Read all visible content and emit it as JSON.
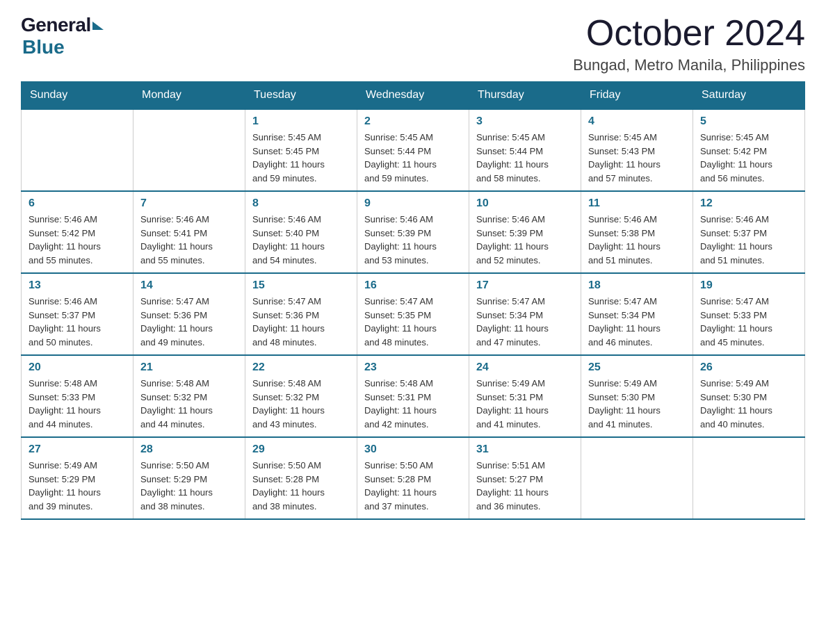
{
  "logo": {
    "general": "General",
    "blue": "Blue"
  },
  "header": {
    "month_year": "October 2024",
    "location": "Bungad, Metro Manila, Philippines"
  },
  "days_of_week": [
    "Sunday",
    "Monday",
    "Tuesday",
    "Wednesday",
    "Thursday",
    "Friday",
    "Saturday"
  ],
  "weeks": [
    [
      {
        "day": "",
        "info": ""
      },
      {
        "day": "",
        "info": ""
      },
      {
        "day": "1",
        "info": "Sunrise: 5:45 AM\nSunset: 5:45 PM\nDaylight: 11 hours\nand 59 minutes."
      },
      {
        "day": "2",
        "info": "Sunrise: 5:45 AM\nSunset: 5:44 PM\nDaylight: 11 hours\nand 59 minutes."
      },
      {
        "day": "3",
        "info": "Sunrise: 5:45 AM\nSunset: 5:44 PM\nDaylight: 11 hours\nand 58 minutes."
      },
      {
        "day": "4",
        "info": "Sunrise: 5:45 AM\nSunset: 5:43 PM\nDaylight: 11 hours\nand 57 minutes."
      },
      {
        "day": "5",
        "info": "Sunrise: 5:45 AM\nSunset: 5:42 PM\nDaylight: 11 hours\nand 56 minutes."
      }
    ],
    [
      {
        "day": "6",
        "info": "Sunrise: 5:46 AM\nSunset: 5:42 PM\nDaylight: 11 hours\nand 55 minutes."
      },
      {
        "day": "7",
        "info": "Sunrise: 5:46 AM\nSunset: 5:41 PM\nDaylight: 11 hours\nand 55 minutes."
      },
      {
        "day": "8",
        "info": "Sunrise: 5:46 AM\nSunset: 5:40 PM\nDaylight: 11 hours\nand 54 minutes."
      },
      {
        "day": "9",
        "info": "Sunrise: 5:46 AM\nSunset: 5:39 PM\nDaylight: 11 hours\nand 53 minutes."
      },
      {
        "day": "10",
        "info": "Sunrise: 5:46 AM\nSunset: 5:39 PM\nDaylight: 11 hours\nand 52 minutes."
      },
      {
        "day": "11",
        "info": "Sunrise: 5:46 AM\nSunset: 5:38 PM\nDaylight: 11 hours\nand 51 minutes."
      },
      {
        "day": "12",
        "info": "Sunrise: 5:46 AM\nSunset: 5:37 PM\nDaylight: 11 hours\nand 51 minutes."
      }
    ],
    [
      {
        "day": "13",
        "info": "Sunrise: 5:46 AM\nSunset: 5:37 PM\nDaylight: 11 hours\nand 50 minutes."
      },
      {
        "day": "14",
        "info": "Sunrise: 5:47 AM\nSunset: 5:36 PM\nDaylight: 11 hours\nand 49 minutes."
      },
      {
        "day": "15",
        "info": "Sunrise: 5:47 AM\nSunset: 5:36 PM\nDaylight: 11 hours\nand 48 minutes."
      },
      {
        "day": "16",
        "info": "Sunrise: 5:47 AM\nSunset: 5:35 PM\nDaylight: 11 hours\nand 48 minutes."
      },
      {
        "day": "17",
        "info": "Sunrise: 5:47 AM\nSunset: 5:34 PM\nDaylight: 11 hours\nand 47 minutes."
      },
      {
        "day": "18",
        "info": "Sunrise: 5:47 AM\nSunset: 5:34 PM\nDaylight: 11 hours\nand 46 minutes."
      },
      {
        "day": "19",
        "info": "Sunrise: 5:47 AM\nSunset: 5:33 PM\nDaylight: 11 hours\nand 45 minutes."
      }
    ],
    [
      {
        "day": "20",
        "info": "Sunrise: 5:48 AM\nSunset: 5:33 PM\nDaylight: 11 hours\nand 44 minutes."
      },
      {
        "day": "21",
        "info": "Sunrise: 5:48 AM\nSunset: 5:32 PM\nDaylight: 11 hours\nand 44 minutes."
      },
      {
        "day": "22",
        "info": "Sunrise: 5:48 AM\nSunset: 5:32 PM\nDaylight: 11 hours\nand 43 minutes."
      },
      {
        "day": "23",
        "info": "Sunrise: 5:48 AM\nSunset: 5:31 PM\nDaylight: 11 hours\nand 42 minutes."
      },
      {
        "day": "24",
        "info": "Sunrise: 5:49 AM\nSunset: 5:31 PM\nDaylight: 11 hours\nand 41 minutes."
      },
      {
        "day": "25",
        "info": "Sunrise: 5:49 AM\nSunset: 5:30 PM\nDaylight: 11 hours\nand 41 minutes."
      },
      {
        "day": "26",
        "info": "Sunrise: 5:49 AM\nSunset: 5:30 PM\nDaylight: 11 hours\nand 40 minutes."
      }
    ],
    [
      {
        "day": "27",
        "info": "Sunrise: 5:49 AM\nSunset: 5:29 PM\nDaylight: 11 hours\nand 39 minutes."
      },
      {
        "day": "28",
        "info": "Sunrise: 5:50 AM\nSunset: 5:29 PM\nDaylight: 11 hours\nand 38 minutes."
      },
      {
        "day": "29",
        "info": "Sunrise: 5:50 AM\nSunset: 5:28 PM\nDaylight: 11 hours\nand 38 minutes."
      },
      {
        "day": "30",
        "info": "Sunrise: 5:50 AM\nSunset: 5:28 PM\nDaylight: 11 hours\nand 37 minutes."
      },
      {
        "day": "31",
        "info": "Sunrise: 5:51 AM\nSunset: 5:27 PM\nDaylight: 11 hours\nand 36 minutes."
      },
      {
        "day": "",
        "info": ""
      },
      {
        "day": "",
        "info": ""
      }
    ]
  ]
}
